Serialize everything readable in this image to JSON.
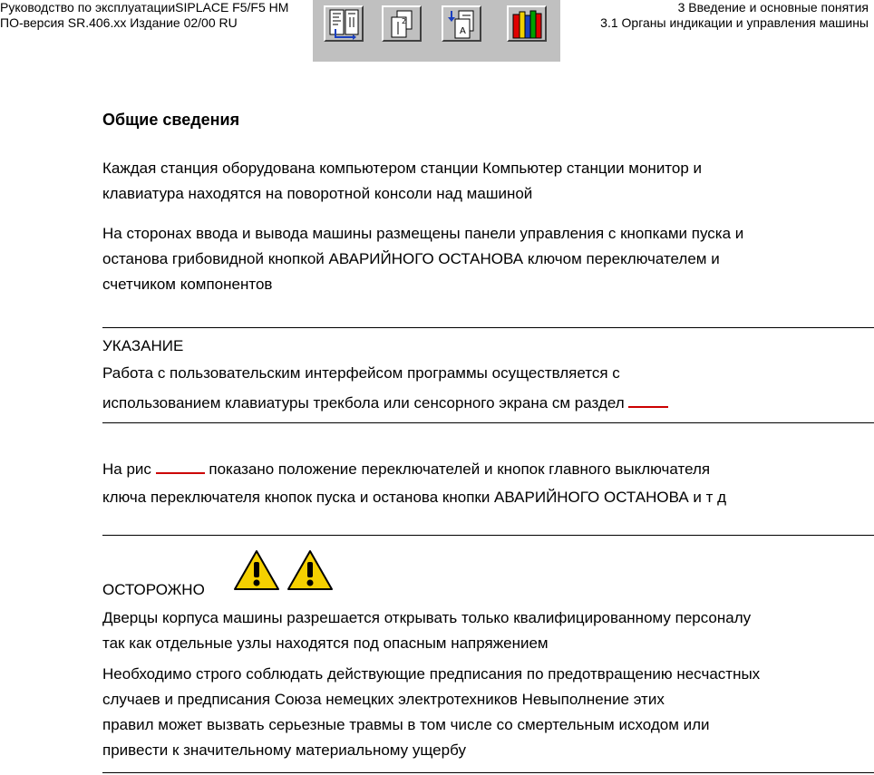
{
  "header": {
    "left_line1": "Руководство по эксплуатацииSIPLACE F5/F5 HM",
    "left_line2": "ПО-версия SR.406.xx   Издание 02/00 RU",
    "right_line1": "3 Введение и основные понятия",
    "right_line2": "3.1 Органы индикации и управления машины"
  },
  "toolbar": {
    "buttons": [
      {
        "icon": "toc-icon"
      },
      {
        "icon": "pages-icon"
      },
      {
        "icon": "index-icon"
      },
      {
        "icon": "library-icon"
      }
    ]
  },
  "section": {
    "title": "Общие сведения",
    "p1_line1": "Каждая станция оборудована компьютером станции  Компьютер станции  монитор и",
    "p1_line2": "клавиатура находятся на поворотной консоли над машиной",
    "p2_line1": "На сторонах ввода и вывода машины размещены панели управления с кнопками пуска и",
    "p2_line2": "останова  грибовидной кнопкой АВАРИЙНОГО ОСТАНОВА  ключом переключателем и",
    "p2_line3": "счетчиком компонентов"
  },
  "note": {
    "label": "УКАЗАНИЕ",
    "line1": "Работа с пользовательским интерфейсом программы       осуществляется с",
    "line2": "использованием клавиатуры  трекбола или сенсорного экрана  см  раздел "
  },
  "figure_ref": {
    "line1_before": "На рис ",
    "line1_after": " показано положение переключателей и кнопок  главного выключателя",
    "line2": "ключа переключателя  кнопок пуска и останова  кнопки АВАРИЙНОГО ОСТАНОВА и т д"
  },
  "caution": {
    "label": "ОСТОРОЖНО",
    "icon": "warning-triangle-icon",
    "line1": "Дверцы корпуса машины разрешается открывать только квалифицированному персоналу",
    "line2": "так как отдельные узлы находятся под опасным напряжением",
    "line3": "Необходимо строго соблюдать действующие предписания по предотвращению несчастных",
    "line4": "случаев и предписания Союза немецких электротехников            Невыполнение этих",
    "line5": "правил может вызвать серьезные травмы  в том числе со смертельным исходом  или",
    "line6": "привести к значительному материальному ущербу"
  },
  "colors": {
    "link_underline": "#cc0000",
    "toolbar_bg": "#c0c0c0",
    "warning_fill": "#f5d000"
  }
}
